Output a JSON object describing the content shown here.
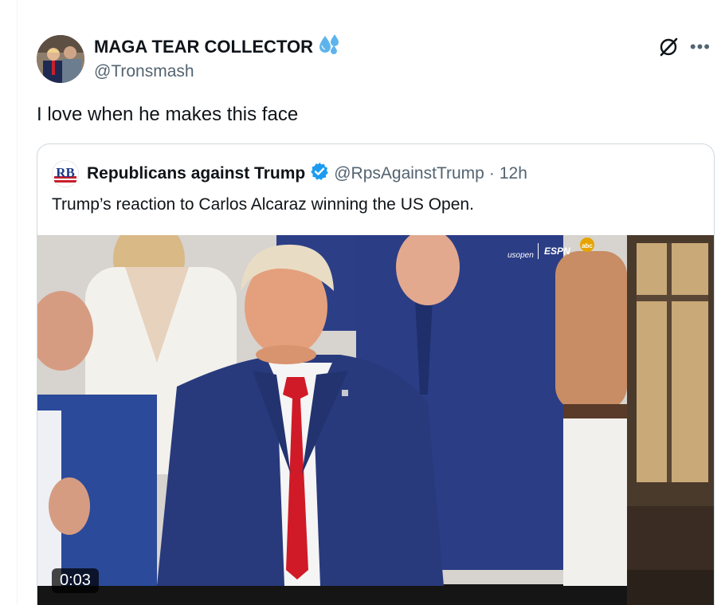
{
  "tweet": {
    "author_name": "MAGA TEAR COLLECTOR",
    "author_handle": "@Tronsmash",
    "text": "I love when he makes this face"
  },
  "quoted": {
    "author_name": "Republicans against Trump",
    "author_handle": "@RpsAgainstTrump",
    "separator": "·",
    "time": "12h",
    "text": "Trump’s reaction to Carlos Alcaraz winning the US Open.",
    "avatar_letters": "RB"
  },
  "video": {
    "duration": "0:03",
    "broadcast_logos": [
      "usopen",
      "ESPN",
      "abc"
    ]
  },
  "colors": {
    "verified_blue": "#1d9bf0",
    "handle_gray": "#536471",
    "border": "#cfd9de",
    "suit_navy": "#283a7c",
    "tie_red": "#d01a28"
  }
}
